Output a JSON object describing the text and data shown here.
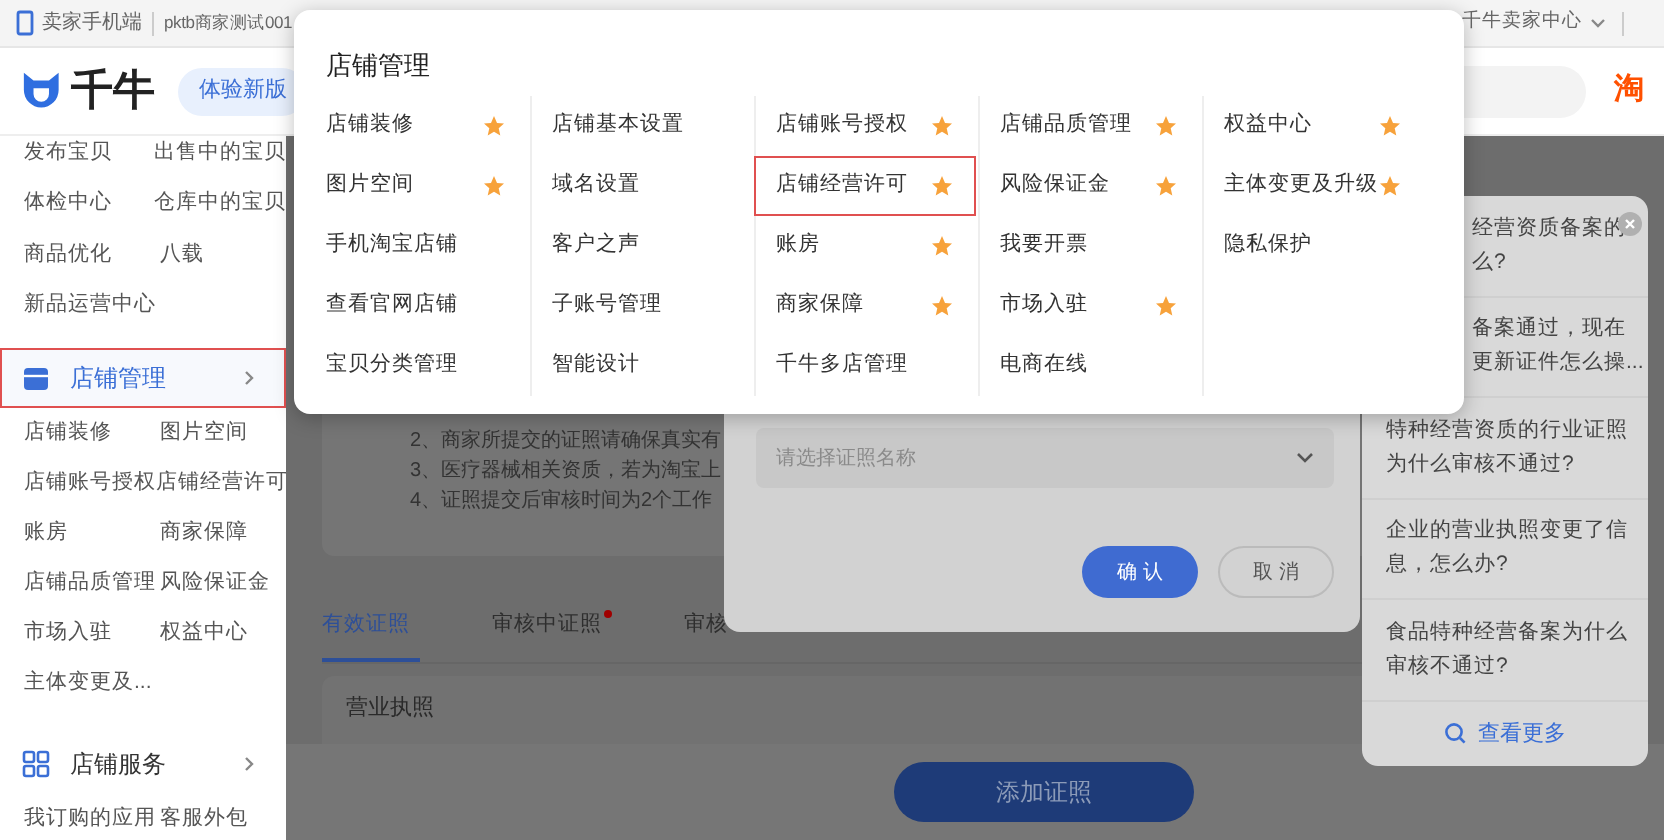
{
  "top_bar": {
    "mobile_link": "卖家手机端",
    "account": "pktb商家测试001",
    "center_menu": "千牛卖家中心"
  },
  "header": {
    "logo_text": "千牛",
    "new_version_button": "体验新版",
    "taobao_mark": "淘"
  },
  "sidebar": {
    "items": [
      [
        "发布宝贝",
        "出售中的宝贝"
      ],
      [
        "体检中心",
        "仓库中的宝贝"
      ],
      [
        "商品优化",
        "八载"
      ],
      [
        "新品运营中心"
      ]
    ],
    "sections": [
      {
        "title": "店铺管理",
        "highlighted": true,
        "items": [
          [
            "店铺装修",
            "图片空间"
          ],
          [
            "店铺账号授权",
            "店铺经营许可"
          ],
          [
            "账房",
            "商家保障"
          ],
          [
            "店铺品质管理",
            "风险保证金"
          ],
          [
            "市场入驻",
            "权益中心"
          ],
          [
            "主体变更及..."
          ]
        ]
      },
      {
        "title": "店铺服务",
        "highlighted": false,
        "items": [
          [
            "我订购的应用",
            "客服外包"
          ]
        ]
      }
    ]
  },
  "main": {
    "notes": [
      "2、商家所提交的证照请确保真实有",
      "3、医疗器械相关资质，若为淘宝上",
      "4、证照提交后审核时间为2个工作"
    ],
    "tabs": [
      {
        "label": "有效证照",
        "selected": true,
        "dot": false
      },
      {
        "label": "审核中证照",
        "selected": false,
        "dot": true
      },
      {
        "label": "审核",
        "selected": false
      }
    ],
    "card_title": "营业执照",
    "add_button": "添加证照"
  },
  "dialog": {
    "placeholder": "请选择证照名称",
    "confirm": "确 认",
    "cancel": "取 消"
  },
  "faq": {
    "items": [
      {
        "lines": [
          "经营资质备案的",
          "么?"
        ]
      },
      {
        "lines": [
          "备案通过，现在",
          "更新证件怎么操..."
        ]
      },
      {
        "lines": [
          "特种经营资质的行业证照",
          "为什么审核不通过?"
        ]
      },
      {
        "lines": [
          "企业的营业执照变更了信",
          "息，怎么办?"
        ]
      },
      {
        "lines": [
          "食品特种经营备案为什么",
          "审核不通过?"
        ]
      }
    ],
    "more": "查看更多"
  },
  "dropdown": {
    "title": "店铺管理",
    "columns": [
      [
        {
          "label": "店铺装修",
          "starred": true,
          "highlighted": false
        },
        {
          "label": "图片空间",
          "starred": true,
          "highlighted": false
        },
        {
          "label": "手机淘宝店铺",
          "starred": false,
          "highlighted": false
        },
        {
          "label": "查看官网店铺",
          "starred": false,
          "highlighted": false
        },
        {
          "label": "宝贝分类管理",
          "starred": false,
          "highlighted": false
        }
      ],
      [
        {
          "label": "店铺基本设置",
          "starred": false,
          "highlighted": false
        },
        {
          "label": "域名设置",
          "starred": false,
          "highlighted": false
        },
        {
          "label": "客户之声",
          "starred": false,
          "highlighted": false
        },
        {
          "label": "子账号管理",
          "starred": false,
          "highlighted": false
        },
        {
          "label": "智能设计",
          "starred": false,
          "highlighted": false
        }
      ],
      [
        {
          "label": "店铺账号授权",
          "starred": true,
          "highlighted": false
        },
        {
          "label": "店铺经营许可",
          "starred": true,
          "highlighted": true
        },
        {
          "label": "账房",
          "starred": true,
          "highlighted": false
        },
        {
          "label": "商家保障",
          "starred": true,
          "highlighted": false
        },
        {
          "label": "千牛多店管理",
          "starred": false,
          "highlighted": false
        }
      ],
      [
        {
          "label": "店铺品质管理",
          "starred": true,
          "highlighted": false
        },
        {
          "label": "风险保证金",
          "starred": true,
          "highlighted": false
        },
        {
          "label": "我要开票",
          "starred": false,
          "highlighted": false
        },
        {
          "label": "市场入驻",
          "starred": true,
          "highlighted": false
        },
        {
          "label": "电商在线",
          "starred": false,
          "highlighted": false
        }
      ],
      [
        {
          "label": "权益中心",
          "starred": true,
          "highlighted": false
        },
        {
          "label": "主体变更及升级",
          "starred": true,
          "highlighted": false
        },
        {
          "label": "隐私保护",
          "starred": false,
          "highlighted": false
        }
      ]
    ]
  }
}
